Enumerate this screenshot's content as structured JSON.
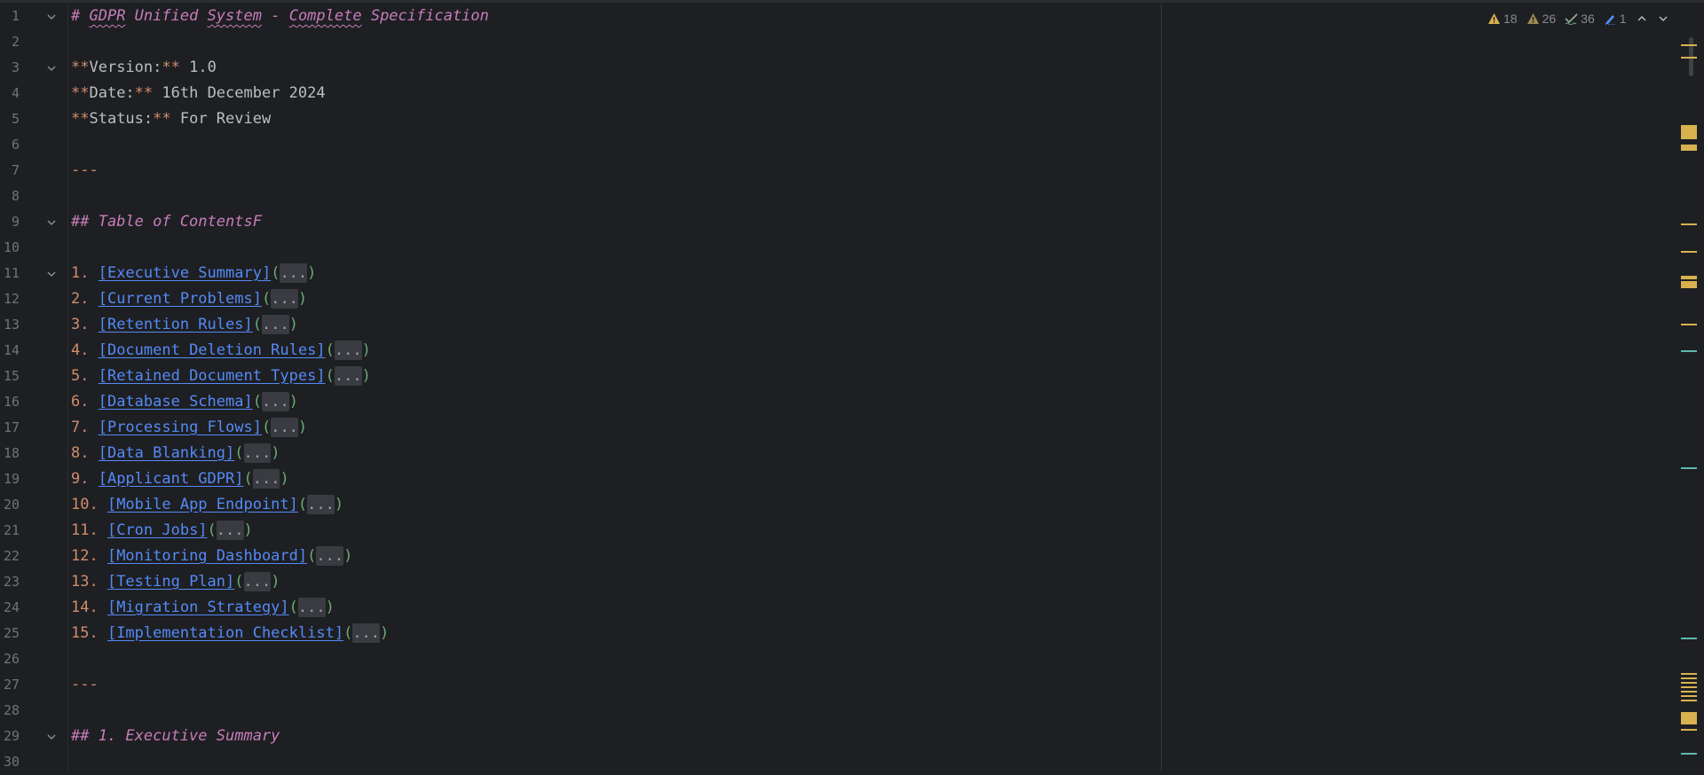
{
  "editor": {
    "lines": [
      {
        "num": "1",
        "fold": true,
        "segs": [
          {
            "t": "# ",
            "c": "h"
          },
          {
            "t": "GDPR",
            "c": "h h1t"
          },
          {
            "t": " Unified ",
            "c": "h"
          },
          {
            "t": "System",
            "c": "h h1t"
          },
          {
            "t": " - ",
            "c": "h"
          },
          {
            "t": "Complete",
            "c": "h h1t"
          },
          {
            "t": " Specification",
            "c": "h"
          }
        ]
      },
      {
        "num": "2",
        "fold": false,
        "segs": []
      },
      {
        "num": "3",
        "fold": true,
        "segs": [
          {
            "t": "**",
            "c": "mk"
          },
          {
            "t": "Version:",
            "c": ""
          },
          {
            "t": "**",
            "c": "mk"
          },
          {
            "t": " 1.0",
            "c": ""
          }
        ]
      },
      {
        "num": "4",
        "fold": false,
        "segs": [
          {
            "t": "**",
            "c": "mk"
          },
          {
            "t": "Date:",
            "c": ""
          },
          {
            "t": "**",
            "c": "mk"
          },
          {
            "t": " 16th December 2024",
            "c": ""
          }
        ]
      },
      {
        "num": "5",
        "fold": false,
        "segs": [
          {
            "t": "**",
            "c": "mk"
          },
          {
            "t": "Status:",
            "c": ""
          },
          {
            "t": "**",
            "c": "mk"
          },
          {
            "t": " For Review",
            "c": ""
          }
        ]
      },
      {
        "num": "6",
        "fold": false,
        "segs": []
      },
      {
        "num": "7",
        "fold": false,
        "segs": [
          {
            "t": "---",
            "c": "sep"
          }
        ]
      },
      {
        "num": "8",
        "fold": false,
        "segs": []
      },
      {
        "num": "9",
        "fold": true,
        "segs": [
          {
            "t": "## Table of ContentsF",
            "c": "h"
          }
        ]
      },
      {
        "num": "10",
        "fold": false,
        "segs": []
      },
      {
        "num": "11",
        "fold": true,
        "segs": [
          {
            "t": "1. ",
            "c": "mk"
          },
          {
            "t": "[Executive Summary]",
            "c": "lnk"
          },
          {
            "t": "(",
            "c": "par"
          },
          {
            "t": "...",
            "c": "ell"
          },
          {
            "t": ")",
            "c": "par"
          }
        ]
      },
      {
        "num": "12",
        "fold": false,
        "segs": [
          {
            "t": "2. ",
            "c": "mk"
          },
          {
            "t": "[Current Problems]",
            "c": "lnk"
          },
          {
            "t": "(",
            "c": "par"
          },
          {
            "t": "...",
            "c": "ell"
          },
          {
            "t": ")",
            "c": "par"
          }
        ]
      },
      {
        "num": "13",
        "fold": false,
        "segs": [
          {
            "t": "3. ",
            "c": "mk"
          },
          {
            "t": "[Retention Rules]",
            "c": "lnk"
          },
          {
            "t": "(",
            "c": "par"
          },
          {
            "t": "...",
            "c": "ell"
          },
          {
            "t": ")",
            "c": "par"
          }
        ]
      },
      {
        "num": "14",
        "fold": false,
        "segs": [
          {
            "t": "4. ",
            "c": "mk"
          },
          {
            "t": "[Document Deletion Rules]",
            "c": "lnk"
          },
          {
            "t": "(",
            "c": "par"
          },
          {
            "t": "...",
            "c": "ell"
          },
          {
            "t": ")",
            "c": "par"
          }
        ]
      },
      {
        "num": "15",
        "fold": false,
        "segs": [
          {
            "t": "5. ",
            "c": "mk"
          },
          {
            "t": "[Retained Document Types]",
            "c": "lnk"
          },
          {
            "t": "(",
            "c": "par"
          },
          {
            "t": "...",
            "c": "ell"
          },
          {
            "t": ")",
            "c": "par"
          }
        ]
      },
      {
        "num": "16",
        "fold": false,
        "segs": [
          {
            "t": "6. ",
            "c": "mk"
          },
          {
            "t": "[Database Schema]",
            "c": "lnk"
          },
          {
            "t": "(",
            "c": "par"
          },
          {
            "t": "...",
            "c": "ell"
          },
          {
            "t": ")",
            "c": "par"
          }
        ]
      },
      {
        "num": "17",
        "fold": false,
        "segs": [
          {
            "t": "7. ",
            "c": "mk"
          },
          {
            "t": "[Processing Flows]",
            "c": "lnk"
          },
          {
            "t": "(",
            "c": "par"
          },
          {
            "t": "...",
            "c": "ell"
          },
          {
            "t": ")",
            "c": "par"
          }
        ]
      },
      {
        "num": "18",
        "fold": false,
        "segs": [
          {
            "t": "8. ",
            "c": "mk"
          },
          {
            "t": "[Data Blanking]",
            "c": "lnk"
          },
          {
            "t": "(",
            "c": "par"
          },
          {
            "t": "...",
            "c": "ell"
          },
          {
            "t": ")",
            "c": "par"
          }
        ]
      },
      {
        "num": "19",
        "fold": false,
        "segs": [
          {
            "t": "9. ",
            "c": "mk"
          },
          {
            "t": "[Applicant GDPR]",
            "c": "lnk"
          },
          {
            "t": "(",
            "c": "par"
          },
          {
            "t": "...",
            "c": "ell"
          },
          {
            "t": ")",
            "c": "par"
          }
        ]
      },
      {
        "num": "20",
        "fold": false,
        "segs": [
          {
            "t": "10. ",
            "c": "mk"
          },
          {
            "t": "[Mobile App Endpoint]",
            "c": "lnk"
          },
          {
            "t": "(",
            "c": "par"
          },
          {
            "t": "...",
            "c": "ell"
          },
          {
            "t": ")",
            "c": "par"
          }
        ]
      },
      {
        "num": "21",
        "fold": false,
        "segs": [
          {
            "t": "11. ",
            "c": "mk"
          },
          {
            "t": "[Cron Jobs]",
            "c": "lnk"
          },
          {
            "t": "(",
            "c": "par"
          },
          {
            "t": "...",
            "c": "ell"
          },
          {
            "t": ")",
            "c": "par"
          }
        ]
      },
      {
        "num": "22",
        "fold": false,
        "segs": [
          {
            "t": "12. ",
            "c": "mk"
          },
          {
            "t": "[Monitoring Dashboard]",
            "c": "lnk"
          },
          {
            "t": "(",
            "c": "par"
          },
          {
            "t": "...",
            "c": "ell"
          },
          {
            "t": ")",
            "c": "par"
          }
        ]
      },
      {
        "num": "23",
        "fold": false,
        "segs": [
          {
            "t": "13. ",
            "c": "mk"
          },
          {
            "t": "[Testing Plan]",
            "c": "lnk"
          },
          {
            "t": "(",
            "c": "par"
          },
          {
            "t": "...",
            "c": "ell"
          },
          {
            "t": ")",
            "c": "par"
          }
        ]
      },
      {
        "num": "24",
        "fold": false,
        "segs": [
          {
            "t": "14. ",
            "c": "mk"
          },
          {
            "t": "[Migration Strategy]",
            "c": "lnk"
          },
          {
            "t": "(",
            "c": "par"
          },
          {
            "t": "...",
            "c": "ell"
          },
          {
            "t": ")",
            "c": "par"
          }
        ]
      },
      {
        "num": "25",
        "fold": false,
        "segs": [
          {
            "t": "15. ",
            "c": "mk"
          },
          {
            "t": "[Implementation Checklist]",
            "c": "lnk"
          },
          {
            "t": "(",
            "c": "par"
          },
          {
            "t": "...",
            "c": "ell"
          },
          {
            "t": ")",
            "c": "par"
          }
        ]
      },
      {
        "num": "26",
        "fold": false,
        "segs": []
      },
      {
        "num": "27",
        "fold": false,
        "segs": [
          {
            "t": "---",
            "c": "sep"
          }
        ]
      },
      {
        "num": "28",
        "fold": false,
        "segs": []
      },
      {
        "num": "29",
        "fold": true,
        "segs": [
          {
            "t": "## 1. Executive Summary",
            "c": "h"
          }
        ]
      },
      {
        "num": "30",
        "fold": false,
        "segs": []
      }
    ]
  },
  "inspections": {
    "warnings_strong": "18",
    "warnings_weak": "26",
    "typos": "36",
    "info": "1",
    "icons": [
      "warning-icon",
      "weak-warning-icon",
      "typo-check-icon",
      "edit-pen-icon",
      "chevron-up-icon",
      "chevron-down-icon"
    ]
  },
  "colors": {
    "background": "#1e1f22",
    "heading": "#c77dbb",
    "markup": "#cf8e6d",
    "link": "#548af7",
    "paren": "#6aab73",
    "warning_mark": "#d8b24f",
    "info_mark": "#5fb8b0"
  }
}
